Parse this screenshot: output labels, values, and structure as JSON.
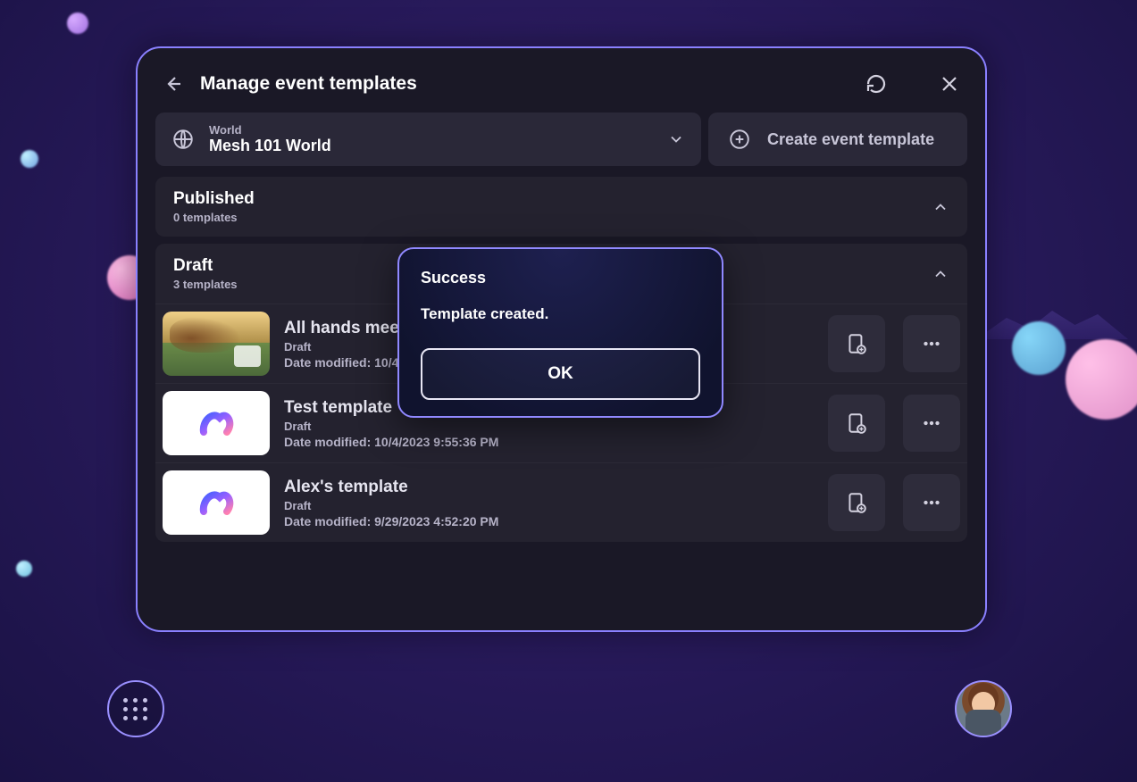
{
  "header": {
    "title": "Manage event templates"
  },
  "world_selector": {
    "label": "World",
    "value": "Mesh 101 World"
  },
  "create_button": "Create event template",
  "sections": {
    "published": {
      "title": "Published",
      "count_label": "0 templates"
    },
    "draft": {
      "title": "Draft",
      "count_label": "3 templates",
      "items": [
        {
          "name": "All hands meeting",
          "status": "Draft",
          "modified": "Date modified: 10/4/20",
          "thumb": "scene"
        },
        {
          "name": "Test template",
          "status": "Draft",
          "modified": "Date modified: 10/4/2023 9:55:36 PM",
          "thumb": "mesh"
        },
        {
          "name": "Alex's template",
          "status": "Draft",
          "modified": "Date modified: 9/29/2023 4:52:20 PM",
          "thumb": "mesh"
        }
      ]
    }
  },
  "modal": {
    "title": "Success",
    "message": "Template created.",
    "ok": "OK"
  }
}
